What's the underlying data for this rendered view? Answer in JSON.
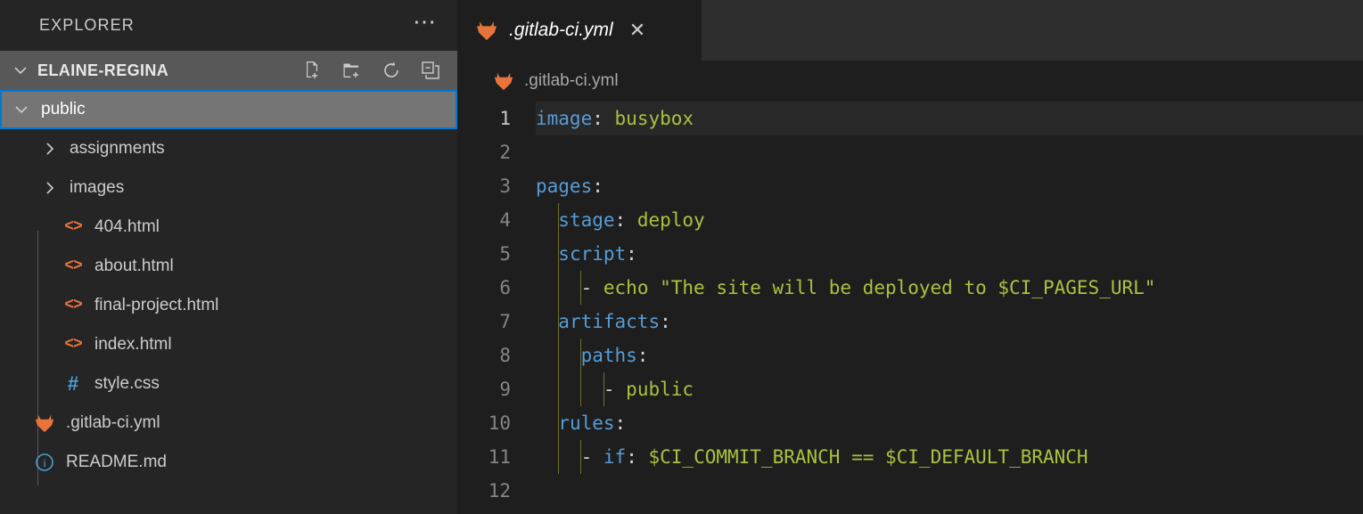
{
  "sidebar": {
    "header": {
      "title": "EXPLORER",
      "more_icon": "ellipsis-icon"
    },
    "root": {
      "label": "ELAINE-REGINA",
      "expanded": true,
      "actions": [
        {
          "name": "new-file-icon",
          "tooltip": "New File"
        },
        {
          "name": "new-folder-icon",
          "tooltip": "New Folder"
        },
        {
          "name": "refresh-icon",
          "tooltip": "Refresh Explorer"
        },
        {
          "name": "collapse-all-icon",
          "tooltip": "Collapse Folders in Explorer"
        }
      ]
    },
    "tree": [
      {
        "label": "public",
        "type": "folder",
        "expanded": true,
        "selected": true,
        "depth": 0
      },
      {
        "label": "assignments",
        "type": "folder",
        "expanded": false,
        "selected": false,
        "depth": 1
      },
      {
        "label": "images",
        "type": "folder",
        "expanded": false,
        "selected": false,
        "depth": 1
      },
      {
        "label": "404.html",
        "type": "html",
        "selected": false,
        "depth": 1
      },
      {
        "label": "about.html",
        "type": "html",
        "selected": false,
        "depth": 1
      },
      {
        "label": "final-project.html",
        "type": "html",
        "selected": false,
        "depth": 1
      },
      {
        "label": "index.html",
        "type": "html",
        "selected": false,
        "depth": 1
      },
      {
        "label": "style.css",
        "type": "css",
        "selected": false,
        "depth": 1
      },
      {
        "label": ".gitlab-ci.yml",
        "type": "gitlab",
        "selected": false,
        "depth": 0
      },
      {
        "label": "README.md",
        "type": "markdown",
        "selected": false,
        "depth": 0
      }
    ]
  },
  "editor": {
    "tab": {
      "label": ".gitlab-ci.yml",
      "icon": "gitlab-icon",
      "preview": true,
      "close_label": "✕"
    },
    "breadcrumb": {
      "label": ".gitlab-ci.yml",
      "icon": "gitlab-icon"
    },
    "active_line": 1,
    "lines": [
      {
        "n": "1",
        "tokens": [
          {
            "t": "image",
            "c": "k"
          },
          {
            "t": ":",
            "c": "p"
          },
          {
            "t": " ",
            "c": "p"
          },
          {
            "t": "busybox",
            "c": "v"
          }
        ]
      },
      {
        "n": "2",
        "tokens": []
      },
      {
        "n": "3",
        "tokens": [
          {
            "t": "pages",
            "c": "k"
          },
          {
            "t": ":",
            "c": "p"
          }
        ]
      },
      {
        "n": "4",
        "tokens": [
          {
            "t": "  ",
            "c": "p"
          },
          {
            "t": "stage",
            "c": "k"
          },
          {
            "t": ":",
            "c": "p"
          },
          {
            "t": " ",
            "c": "p"
          },
          {
            "t": "deploy",
            "c": "v"
          }
        ]
      },
      {
        "n": "5",
        "tokens": [
          {
            "t": "  ",
            "c": "p"
          },
          {
            "t": "script",
            "c": "k"
          },
          {
            "t": ":",
            "c": "p"
          }
        ]
      },
      {
        "n": "6",
        "tokens": [
          {
            "t": "    ",
            "c": "p"
          },
          {
            "t": "-",
            "c": "d"
          },
          {
            "t": " ",
            "c": "p"
          },
          {
            "t": "echo \"The site will be deployed to $CI_PAGES_URL\"",
            "c": "v"
          }
        ]
      },
      {
        "n": "7",
        "tokens": [
          {
            "t": "  ",
            "c": "p"
          },
          {
            "t": "artifacts",
            "c": "k"
          },
          {
            "t": ":",
            "c": "p"
          }
        ]
      },
      {
        "n": "8",
        "tokens": [
          {
            "t": "    ",
            "c": "p"
          },
          {
            "t": "paths",
            "c": "k"
          },
          {
            "t": ":",
            "c": "p"
          }
        ]
      },
      {
        "n": "9",
        "tokens": [
          {
            "t": "      ",
            "c": "p"
          },
          {
            "t": "-",
            "c": "d"
          },
          {
            "t": " ",
            "c": "p"
          },
          {
            "t": "public",
            "c": "v"
          }
        ]
      },
      {
        "n": "10",
        "tokens": [
          {
            "t": "  ",
            "c": "p"
          },
          {
            "t": "rules",
            "c": "k"
          },
          {
            "t": ":",
            "c": "p"
          }
        ]
      },
      {
        "n": "11",
        "tokens": [
          {
            "t": "    ",
            "c": "p"
          },
          {
            "t": "-",
            "c": "d"
          },
          {
            "t": " ",
            "c": "p"
          },
          {
            "t": "if",
            "c": "k"
          },
          {
            "t": ":",
            "c": "p"
          },
          {
            "t": " ",
            "c": "p"
          },
          {
            "t": "$CI_COMMIT_BRANCH == $CI_DEFAULT_BRANCH",
            "c": "v"
          }
        ]
      },
      {
        "n": "12",
        "tokens": []
      }
    ]
  },
  "colors": {
    "sidebar_bg": "#252526",
    "editor_bg": "#1e1e1e",
    "tabbar_bg": "#2d2d2d",
    "selection_bg": "#757575",
    "focus_border": "#0078d4",
    "root_row_bg": "#585858",
    "key": "#569cd6",
    "value": "#a9c23f",
    "text": "#d4d4d4",
    "linenumber": "#858585",
    "gitlab_orange": "#e8743b",
    "html_icon": "#e8743b",
    "css_icon": "#4a9fd4",
    "md_icon": "#4a9fd4"
  }
}
